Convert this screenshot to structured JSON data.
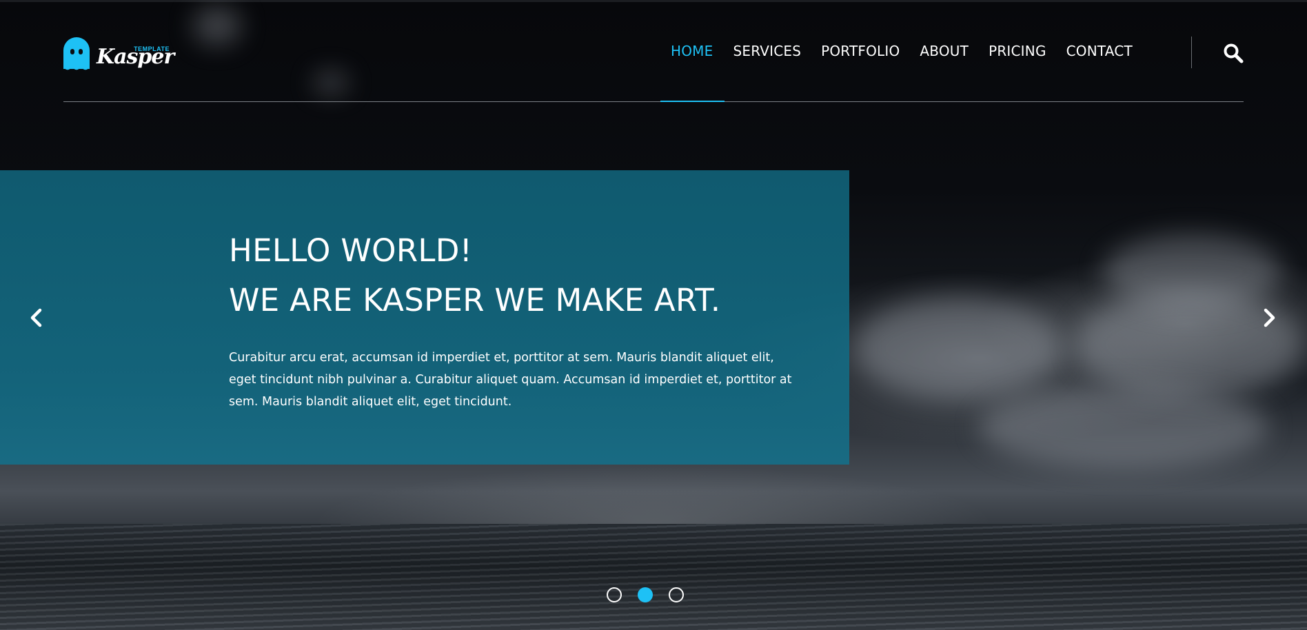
{
  "brand": {
    "name": "Kasper",
    "tagline": "TEMPLATE",
    "accent_color": "#1ec1f5",
    "icon": "ghost-logo-icon"
  },
  "nav": {
    "items": [
      {
        "label": "HOME",
        "active": true
      },
      {
        "label": "SERVICES",
        "active": false
      },
      {
        "label": "PORTFOLIO",
        "active": false
      },
      {
        "label": "ABOUT",
        "active": false
      },
      {
        "label": "PRICING",
        "active": false
      },
      {
        "label": "CONTACT",
        "active": false
      }
    ],
    "search_icon": "search-icon"
  },
  "slider": {
    "title_line1": "HELLO WORLD!",
    "title_line2": "WE ARE KASPER WE MAKE ART.",
    "text": "Curabitur arcu erat, accumsan id imperdiet et, porttitor at sem. Mauris blandit aliquet elit, eget tincidunt nibh pulvinar a. Curabitur aliquet quam. Accumsan id imperdiet et, porttitor at sem. Mauris blandit aliquet elit, eget tincidunt.",
    "prev_icon": "chevron-left-icon",
    "next_icon": "chevron-right-icon",
    "box_color": "#106076",
    "slide_count": 3,
    "active_slide": 2
  }
}
